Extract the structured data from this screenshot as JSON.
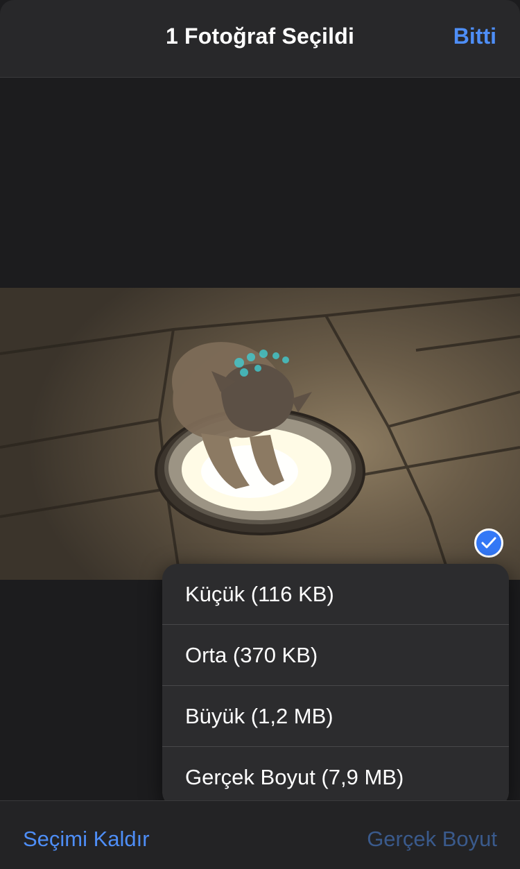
{
  "header": {
    "title": "1 Fotoğraf Seçildi",
    "done_label": "Bitti"
  },
  "photo": {
    "selected": true
  },
  "size_menu": {
    "items": [
      {
        "label": "Küçük (116 KB)"
      },
      {
        "label": "Orta (370 KB)"
      },
      {
        "label": "Büyük (1,2 MB)"
      },
      {
        "label": "Gerçek Boyut (7,9 MB)"
      }
    ]
  },
  "bottom_bar": {
    "deselect_label": "Seçimi Kaldır",
    "size_label": "Gerçek Boyut"
  },
  "colors": {
    "accent": "#4e8ef7",
    "check_badge": "#3478f6",
    "background": "#1c1c1e",
    "menu_background": "#2c2c2e"
  },
  "icons": {
    "check": "checkmark-icon"
  }
}
